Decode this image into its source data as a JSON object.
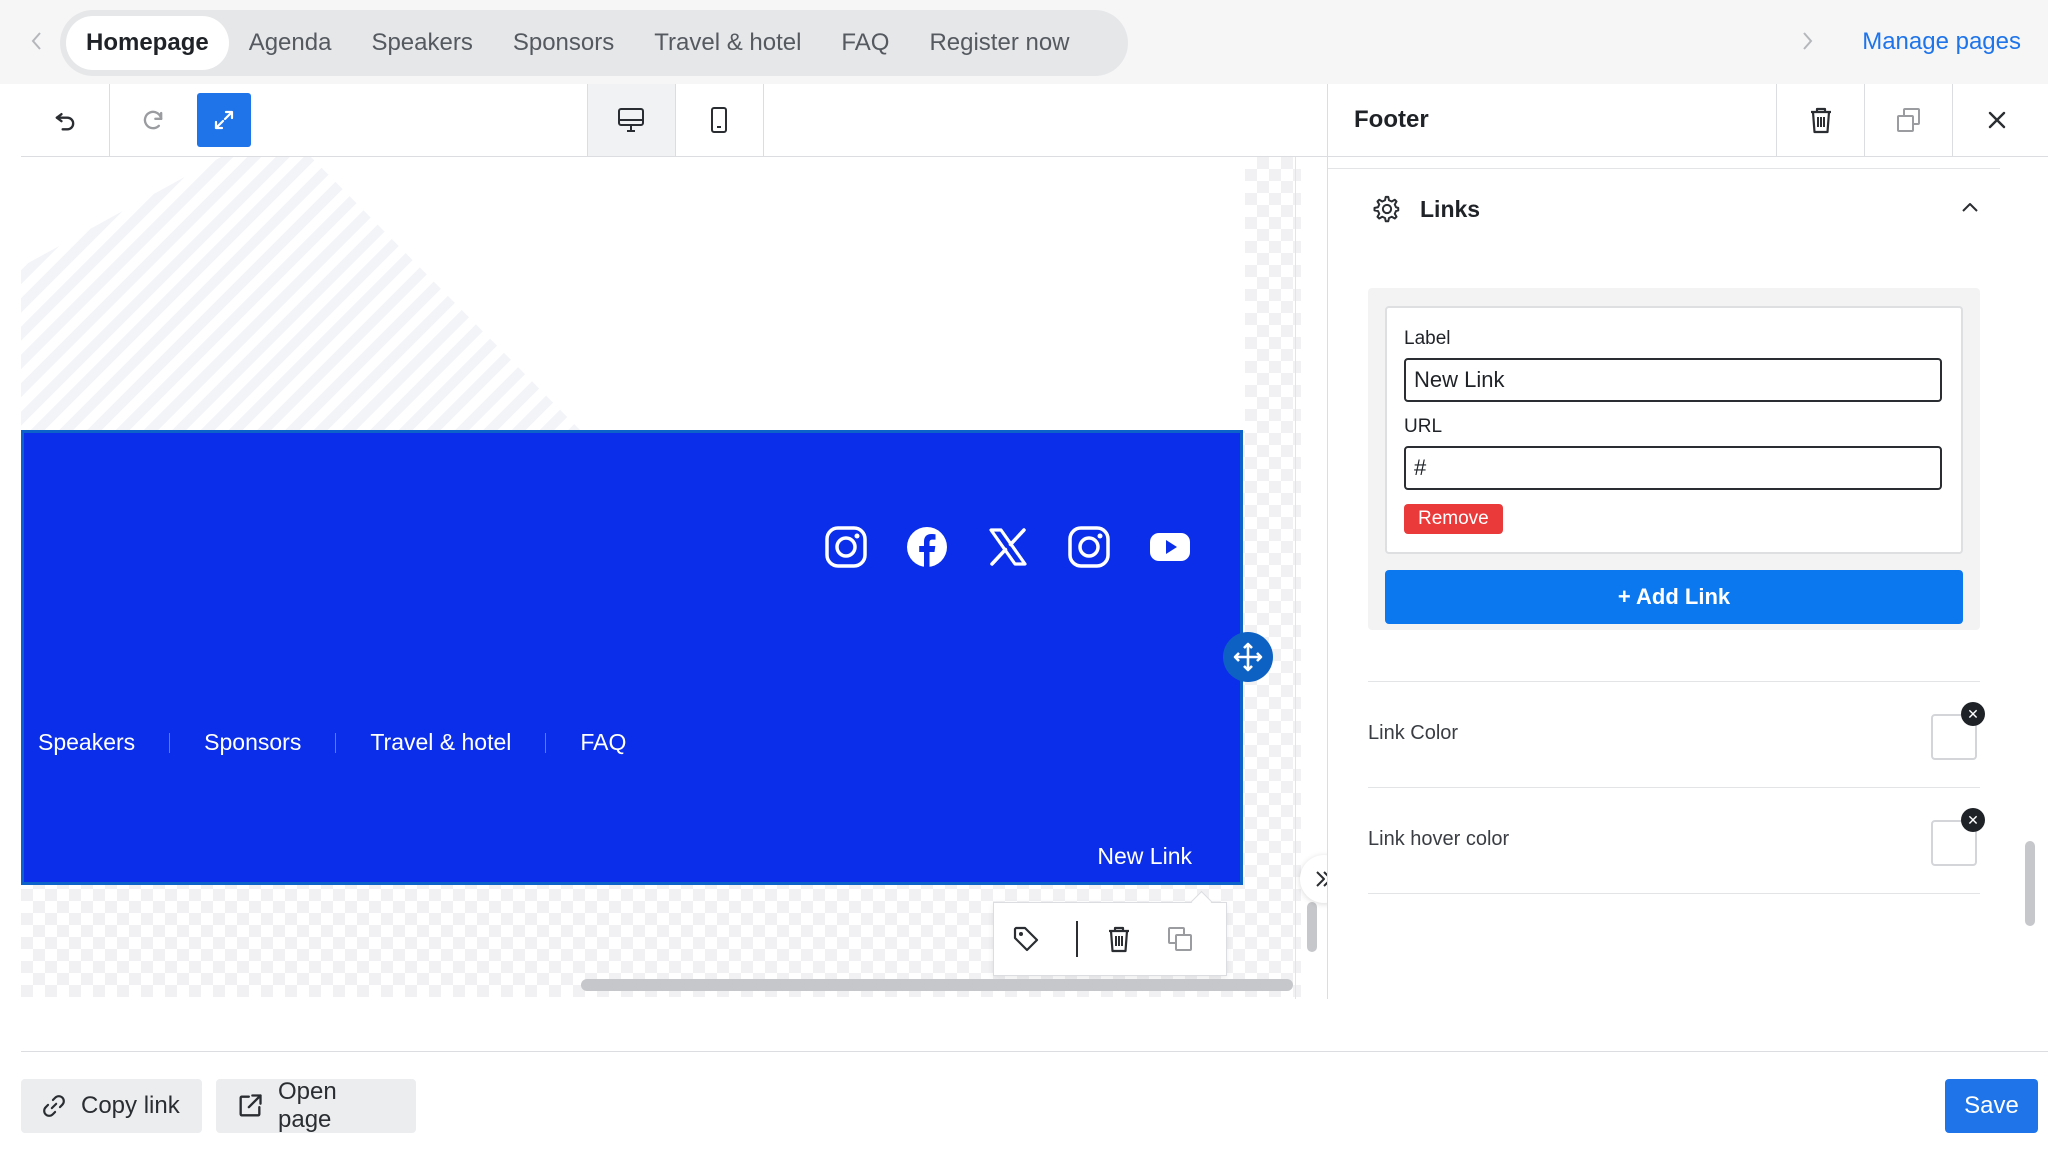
{
  "page_tabs": {
    "items": [
      "Homepage",
      "Agenda",
      "Speakers",
      "Sponsors",
      "Travel & hotel",
      "FAQ",
      "Register now"
    ],
    "active_index": 0,
    "manage_label": "Manage pages"
  },
  "toolbar": {
    "undo_icon": "undo-icon",
    "redo_icon": "redo-icon",
    "expand_icon": "expand-icon",
    "desktop_icon": "desktop-icon",
    "mobile_icon": "mobile-icon",
    "accent": "#1f74ea"
  },
  "canvas": {
    "footer_bg": "#0a2ee9",
    "social_icons": [
      "instagram-icon",
      "facebook-icon",
      "x-twitter-icon",
      "instagram-icon",
      "youtube-icon"
    ],
    "footer_nav": [
      "Speakers",
      "Sponsors",
      "Travel & hotel",
      "FAQ"
    ],
    "footer_link": "New Link"
  },
  "panel": {
    "title": "Footer",
    "section_title": "Links",
    "link_item": {
      "label_title": "Label",
      "label_value": "New Link",
      "url_title": "URL",
      "url_value": "#",
      "remove_label": "Remove"
    },
    "add_link_label": "+ Add Link",
    "options": [
      {
        "label": "Link Color"
      },
      {
        "label": "Link hover color"
      }
    ]
  },
  "bottom": {
    "copy_link_label": "Copy link",
    "open_page_label": "Open page",
    "save_label": "Save"
  }
}
